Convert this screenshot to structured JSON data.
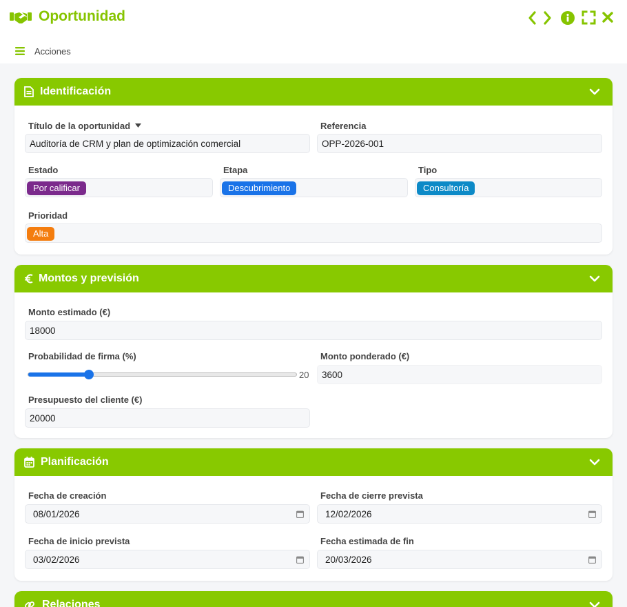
{
  "window": {
    "title": "Oportunidad",
    "menu_label": "Acciones",
    "accent_color": "#86c400"
  },
  "sections": {
    "identificacion": {
      "title": "Identificación",
      "titulo_label": "Título de la oportunidad",
      "titulo_value": "Auditoría de CRM y plan de optimización comercial",
      "referencia_label": "Referencia",
      "referencia_value": "OPP-2026-001",
      "estado_label": "Estado",
      "estado_value": "Por calificar",
      "estado_color": "#7b2a8c",
      "etapa_label": "Etapa",
      "etapa_value": "Descubrimiento",
      "etapa_color": "#1a73e8",
      "tipo_label": "Tipo",
      "tipo_value": "Consultoría",
      "tipo_color": "#0d8ac7",
      "prioridad_label": "Prioridad",
      "prioridad_value": "Alta",
      "prioridad_color": "#f47d0f"
    },
    "montos": {
      "title": "Montos y previsión",
      "monto_estimado_label": "Monto estimado (€)",
      "monto_estimado_value": "18000",
      "probabilidad_label": "Probabilidad de firma (%)",
      "probabilidad_value": 20,
      "probabilidad_text": "20",
      "probabilidad_max": 100,
      "monto_ponderado_label": "Monto ponderado (€)",
      "monto_ponderado_value": "3600",
      "presupuesto_label": "Presupuesto del cliente (€)",
      "presupuesto_value": "20000"
    },
    "planificacion": {
      "title": "Planificación",
      "fecha_creacion_label": "Fecha de creación",
      "fecha_creacion_value": "08/01/2026",
      "fecha_cierre_label": "Fecha de cierre prevista",
      "fecha_cierre_value": "12/02/2026",
      "fecha_inicio_label": "Fecha de inicio prevista",
      "fecha_inicio_value": "03/02/2026",
      "fecha_fin_label": "Fecha estimada de fin",
      "fecha_fin_value": "20/03/2026"
    },
    "relaciones": {
      "title": "Relaciones"
    }
  }
}
